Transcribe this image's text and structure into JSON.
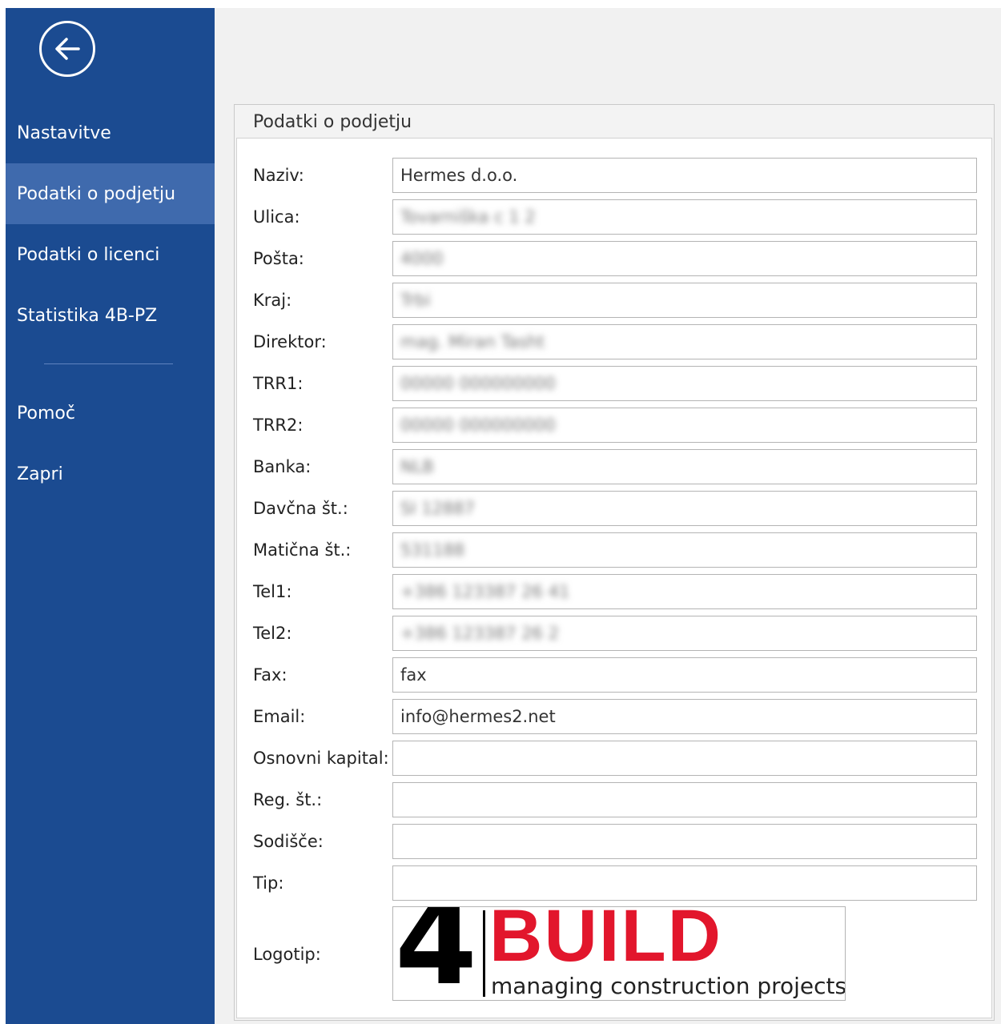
{
  "sidebar": {
    "back_icon": "arrow-left-circle-icon",
    "items": [
      {
        "label": "Nastavitve"
      },
      {
        "label": "Podatki o podjetju",
        "active": true
      },
      {
        "label": "Podatki o licenci"
      },
      {
        "label": "Statistika 4B-PZ"
      },
      {
        "label": "Pomoč"
      },
      {
        "label": "Zapri"
      }
    ]
  },
  "panel": {
    "title": "Podatki o podjetju"
  },
  "fields": {
    "naziv": {
      "label": "Naziv:",
      "value": "Hermes d.o.o."
    },
    "ulica": {
      "label": "Ulica:",
      "value": "Tovarniška c 1 2"
    },
    "posta": {
      "label": "Pošta:",
      "value": "4000"
    },
    "kraj": {
      "label": "Kraj:",
      "value": "Trbi"
    },
    "direktor": {
      "label": "Direktor:",
      "value": "mag. Miran Tasht"
    },
    "trr1": {
      "label": "TRR1:",
      "value": "00000 000000000"
    },
    "trr2": {
      "label": "TRR2:",
      "value": "00000 000000000"
    },
    "banka": {
      "label": "Banka:",
      "value": "NLB"
    },
    "davcna": {
      "label": "Davčna št.:",
      "value": "SI 12887"
    },
    "maticna": {
      "label": "Matična št.:",
      "value": "531188"
    },
    "tel1": {
      "label": "Tel1:",
      "value": "+386 123387 26 41"
    },
    "tel2": {
      "label": "Tel2:",
      "value": "+386 123387 26 2"
    },
    "fax": {
      "label": "Fax:",
      "value": "fax"
    },
    "email": {
      "label": "Email:",
      "value": "info@hermes2.net"
    },
    "kapital": {
      "label": "Osnovni kapital:",
      "value": ""
    },
    "reg": {
      "label": "Reg. št.:",
      "value": ""
    },
    "sodisce": {
      "label": "Sodišče:",
      "value": ""
    },
    "tip": {
      "label": "Tip:",
      "value": ""
    },
    "logotip": {
      "label": "Logotip:"
    }
  },
  "logo": {
    "number": "4",
    "word": "BUILD",
    "tagline": "managing construction projects",
    "colors": {
      "word": "#e2162c",
      "number": "#000000"
    }
  },
  "colors": {
    "sidebar_bg": "#1b4b91",
    "sidebar_active": "#3f6aad",
    "content_bg": "#f1f1f1"
  }
}
